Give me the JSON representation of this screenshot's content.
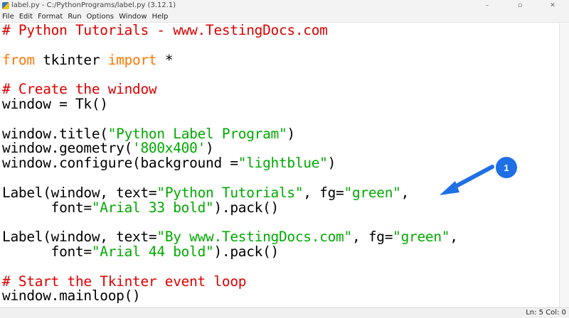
{
  "window": {
    "title": "label.py - C:/PythonPrograms/label.py (3.12.1)",
    "controls": {
      "minimize": "–",
      "maximize": "▫",
      "close": "✕"
    }
  },
  "menu": {
    "items": [
      "File",
      "Edit",
      "Format",
      "Run",
      "Options",
      "Window",
      "Help"
    ]
  },
  "editor": {
    "lines": [
      [
        {
          "t": "# Python Tutorials - www.TestingDocs.com",
          "c": "comment"
        }
      ],
      [],
      [
        {
          "t": "from",
          "c": "keyword"
        },
        {
          "t": " tkinter ",
          "c": "plain"
        },
        {
          "t": "import",
          "c": "keyword"
        },
        {
          "t": " *",
          "c": "plain"
        }
      ],
      [],
      [
        {
          "t": "# Create the window",
          "c": "comment"
        }
      ],
      [
        {
          "t": "window = Tk()",
          "c": "plain"
        }
      ],
      [],
      [
        {
          "t": "window.title(",
          "c": "plain"
        },
        {
          "t": "\"Python Label Program\"",
          "c": "string"
        },
        {
          "t": ")",
          "c": "plain"
        }
      ],
      [
        {
          "t": "window.geometry(",
          "c": "plain"
        },
        {
          "t": "'800x400'",
          "c": "string"
        },
        {
          "t": ")",
          "c": "plain"
        }
      ],
      [
        {
          "t": "window.configure(background =",
          "c": "plain"
        },
        {
          "t": "\"lightblue\"",
          "c": "string"
        },
        {
          "t": ")",
          "c": "plain"
        }
      ],
      [],
      [
        {
          "t": "Label(window, text=",
          "c": "plain"
        },
        {
          "t": "\"Python Tutorials\"",
          "c": "string"
        },
        {
          "t": ", fg=",
          "c": "plain"
        },
        {
          "t": "\"green\"",
          "c": "string"
        },
        {
          "t": ",",
          "c": "plain"
        }
      ],
      [
        {
          "t": "      font=",
          "c": "plain"
        },
        {
          "t": "\"Arial 33 bold\"",
          "c": "string"
        },
        {
          "t": ").pack()",
          "c": "plain"
        }
      ],
      [],
      [
        {
          "t": "Label(window, text=",
          "c": "plain"
        },
        {
          "t": "\"By www.TestingDocs.com\"",
          "c": "string"
        },
        {
          "t": ", fg=",
          "c": "plain"
        },
        {
          "t": "\"green\"",
          "c": "string"
        },
        {
          "t": ",",
          "c": "plain"
        }
      ],
      [
        {
          "t": "      font=",
          "c": "plain"
        },
        {
          "t": "\"Arial 44 bold\"",
          "c": "string"
        },
        {
          "t": ").pack()",
          "c": "plain"
        }
      ],
      [],
      [
        {
          "t": "# Start the Tkinter event loop",
          "c": "comment"
        }
      ],
      [
        {
          "t": "window.mainloop()",
          "c": "plain"
        }
      ]
    ]
  },
  "annotation": {
    "badge": "1",
    "color": "#1f6fe5"
  },
  "status": {
    "position": "Ln: 5  Col: 0"
  },
  "colors": {
    "comment": "#dd0000",
    "keyword": "#ff7700",
    "string": "#00aa00",
    "plain": "#000000"
  }
}
